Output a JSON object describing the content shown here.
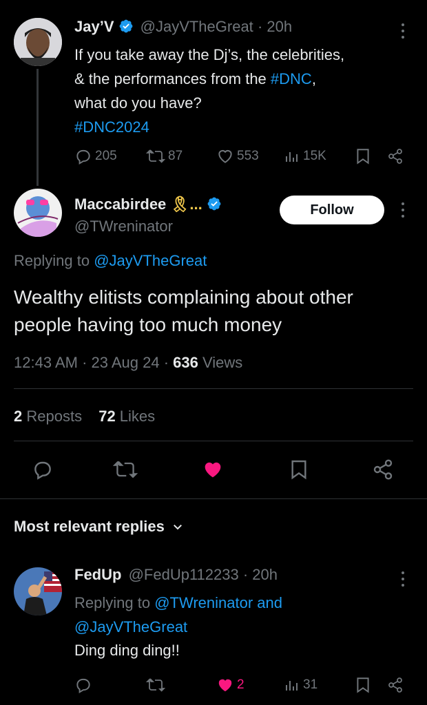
{
  "tweet1": {
    "name": "Jay’V",
    "handle": "@JayVTheGreat",
    "time": "· 20h",
    "line1": "If you take away the Dj’s, the celebrities,",
    "line2_a": "& the performances from the ",
    "line2_tag": "#DNC",
    "line2_b": ",",
    "line3": "what do you have?",
    "line4_tag": "#DNC2024",
    "replies": "205",
    "reposts": "87",
    "likes": "553",
    "views": "15K"
  },
  "tweet2": {
    "name": "Maccabirdee",
    "name_suffix": "🎗...",
    "handle": "@TWreninator",
    "follow_label": "Follow",
    "replying_prefix": "Replying to ",
    "replying_to": "@JayVTheGreat",
    "text_line1": "Wealthy elitists complaining about other",
    "text_line2": "people having too much money",
    "time": "12:43 AM · 23 Aug 24 · ",
    "views_count": "636",
    "views_label": " Views",
    "reposts_count": "2",
    "reposts_label": " Reposts",
    "likes_count": "72",
    "likes_label": " Likes"
  },
  "section": {
    "title": "Most relevant replies"
  },
  "reply1": {
    "name": "FedUp",
    "handle": "@FedUp112233",
    "time": "· 20h",
    "replying_prefix": "Replying to ",
    "replying_to1": "@TWreninator and",
    "replying_to2": "@JayVTheGreat",
    "text": "Ding ding ding!!",
    "likes": "2",
    "views": "31"
  },
  "colors": {
    "accent": "#1d9bf0",
    "like": "#f91880",
    "muted": "#71767b",
    "background": "#000000"
  }
}
